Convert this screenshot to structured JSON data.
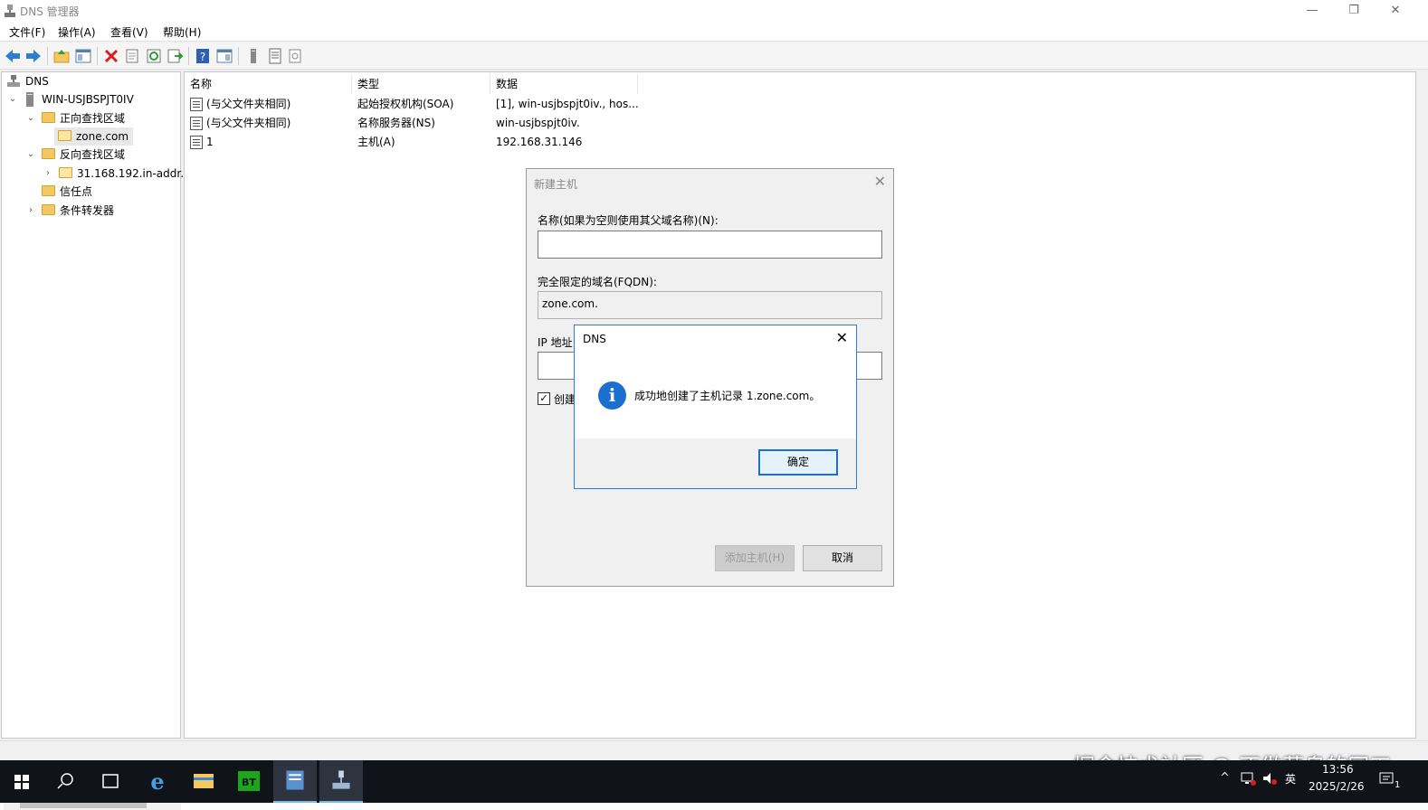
{
  "window": {
    "title": "DNS 管理器",
    "controls": {
      "minimize": "—",
      "restore": "❐",
      "close": "✕"
    }
  },
  "menu": {
    "file": "文件(F)",
    "action": "操作(A)",
    "view": "查看(V)",
    "help": "帮助(H)"
  },
  "tree": {
    "root": "DNS",
    "server": "WIN-USJBSPJT0IV",
    "forward": "正向查找区域",
    "zone": "zone.com",
    "reverse": "反向查找区域",
    "reverse_zone": "31.168.192.in-addr.",
    "trust": "信任点",
    "conditional": "条件转发器"
  },
  "list": {
    "headers": {
      "name": "名称",
      "type": "类型",
      "data": "数据"
    },
    "rows": [
      {
        "name": "(与父文件夹相同)",
        "type": "起始授权机构(SOA)",
        "data": "[1], win-usjbspjt0iv., hos..."
      },
      {
        "name": "(与父文件夹相同)",
        "type": "名称服务器(NS)",
        "data": "win-usjbspjt0iv."
      },
      {
        "name": "1",
        "type": "主机(A)",
        "data": "192.168.31.146"
      }
    ]
  },
  "new_host_dialog": {
    "title": "新建主机",
    "name_label": "名称(如果为空则使用其父域名称)(N):",
    "name_value": "",
    "fqdn_label": "完全限定的域名(FQDN):",
    "fqdn_value": "zone.com.",
    "ip_label": "IP 地址",
    "ip_value": "",
    "checkbox_label": "创建",
    "checkbox_checked": true,
    "add_button": "添加主机(H)",
    "cancel_button": "取消"
  },
  "message_box": {
    "title": "DNS",
    "text": "成功地创建了主机记录 1.zone.com。",
    "ok_button": "确定"
  },
  "taskbar": {
    "ime": "英",
    "time": "13:56",
    "date": "2025/2/26",
    "notif_count": "1"
  },
  "watermark": "掘金技术社区 @ 不做菜鸟的网工"
}
